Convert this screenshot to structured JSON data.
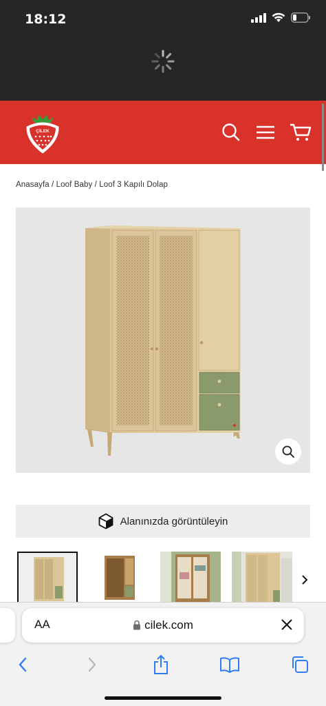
{
  "status_bar": {
    "time": "18:12",
    "battery_level": 0.2
  },
  "header": {
    "brand": "ÇİLEK",
    "brand_color": "#d9322b",
    "icons": [
      "search-icon",
      "menu-icon",
      "cart-icon"
    ]
  },
  "breadcrumb": {
    "items": [
      "Anasayfa",
      "Loof Baby",
      "Loof 3 Kapılı Dolap"
    ],
    "separator": " / "
  },
  "product": {
    "ar_button_label": "Alanınızda görüntüleyin",
    "thumbnail_count_visible": 4
  },
  "browser": {
    "text_size_label": "AA",
    "url": "cilek.com"
  }
}
